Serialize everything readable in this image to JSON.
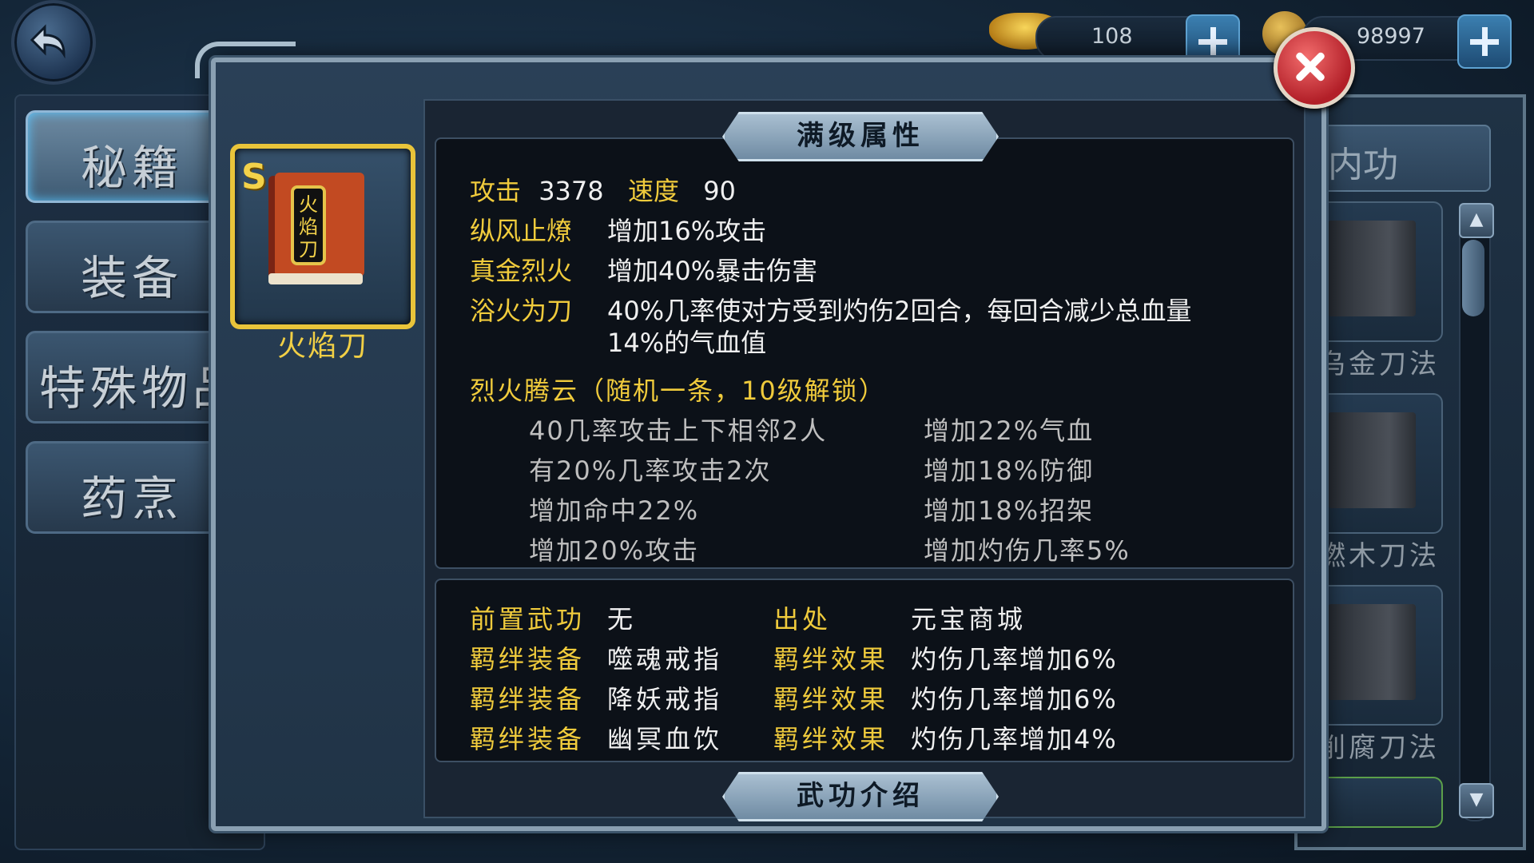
{
  "topbar": {
    "gold_ingot": "108",
    "coins": "98997"
  },
  "menu": {
    "items": [
      {
        "label": "秘籍",
        "active": true
      },
      {
        "label": "装备",
        "active": false
      },
      {
        "label": "特殊物品",
        "active": false
      },
      {
        "label": "药烹",
        "active": false
      }
    ]
  },
  "right_list": {
    "tab_label": "内功",
    "books": [
      "乌金刀法",
      "燃木刀法",
      "削腐刀法"
    ]
  },
  "item": {
    "grade": "S",
    "name": "火焰刀",
    "icon_text": "火焰刀"
  },
  "full_level": {
    "title": "满级属性",
    "attack_label": "攻击",
    "attack_value": "3378",
    "speed_label": "速度",
    "speed_value": "90",
    "effects": [
      {
        "name": "纵风止燎",
        "desc": "增加16%攻击"
      },
      {
        "name": "真金烈火",
        "desc": "增加40%暴击伤害"
      },
      {
        "name": "浴火为刀",
        "desc": "40%几率使对方受到灼伤2回合，每回合减少总血量",
        "desc2": "14%的气血值"
      }
    ],
    "random_title": "烈火腾云（随机一条，10级解锁）",
    "random_left": [
      "40几率攻击上下相邻2人",
      "有20%几率攻击2次",
      "增加命中22%",
      "增加20%攻击"
    ],
    "random_right": [
      "增加22%气血",
      "增加18%防御",
      "增加18%招架",
      "增加灼伤几率5%"
    ]
  },
  "info": {
    "prereq_label": "前置武功",
    "prereq_value": "无",
    "source_label": "出处",
    "source_value": "元宝商城",
    "bonds": [
      {
        "equip_label": "羁绊装备",
        "equip": "噬魂戒指",
        "effect_label": "羁绊效果",
        "effect": "灼伤几率增加6%"
      },
      {
        "equip_label": "羁绊装备",
        "equip": "降妖戒指",
        "effect_label": "羁绊效果",
        "effect": "灼伤几率增加6%"
      },
      {
        "equip_label": "羁绊装备",
        "equip": "幽冥血饮",
        "effect_label": "羁绊效果",
        "effect": "灼伤几率增加4%"
      }
    ]
  },
  "intro_title": "武功介绍",
  "colors": {
    "label_gold": "#f0cb3c",
    "frame_gold": "#e9c43a",
    "close_red": "#c8262f"
  }
}
